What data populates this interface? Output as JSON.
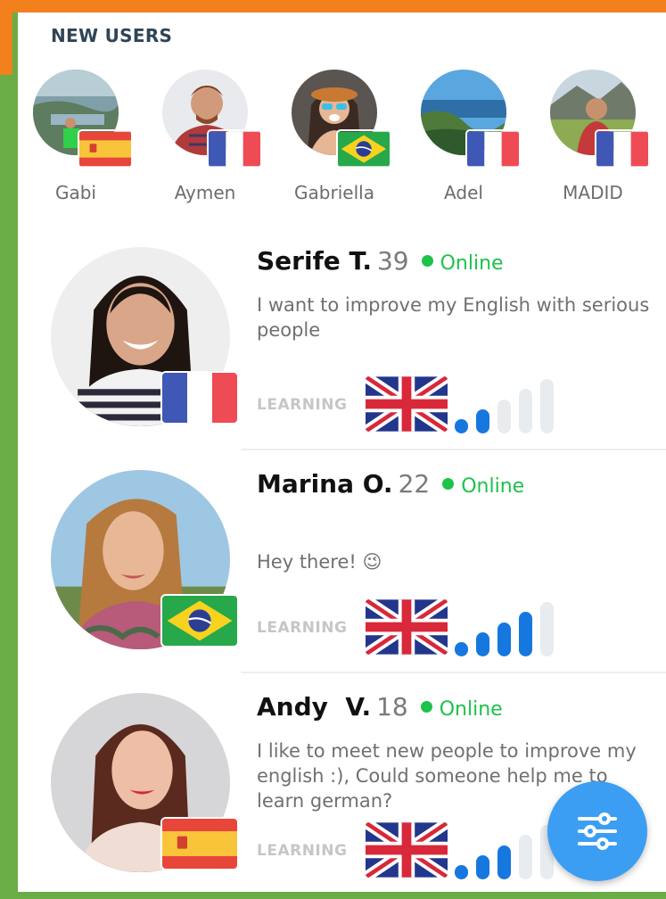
{
  "section": {
    "title": "NEW USERS"
  },
  "new_users": [
    {
      "name": "Gabi",
      "flag": "spain-flag"
    },
    {
      "name": "Aymen",
      "flag": "france-flag"
    },
    {
      "name": "Gabriella",
      "flag": "brazil-flag"
    },
    {
      "name": "Adel",
      "flag": "france-flag"
    },
    {
      "name": "MADID",
      "flag": "france-flag"
    }
  ],
  "users": [
    {
      "name": "Serife T.",
      "age": "39",
      "status": "Online",
      "bio": "I want to improve my English with serious people",
      "flag": "france-flag",
      "learning_label": "LEARNING",
      "learning_flag": "uk-flag",
      "level": 2,
      "level_max": 5
    },
    {
      "name": "Marina O.",
      "age": "22",
      "status": "Online",
      "bio": "Hey there! 😉",
      "flag": "brazil-flag",
      "learning_label": "LEARNING",
      "learning_flag": "uk-flag",
      "level": 4,
      "level_max": 5
    },
    {
      "name": "Andy  V.",
      "age": "18",
      "status": "Online",
      "bio": "I like to meet new people to improve my english :), Could someone help me to learn german?",
      "flag": "spain-flag",
      "learning_label": "LEARNING",
      "learning_flag": "uk-flag",
      "level": 3,
      "level_max": 5
    }
  ],
  "filter_button": {
    "icon": "sliders-icon"
  },
  "colors": {
    "accent": "#3b9ef3",
    "online": "#1dc24a",
    "level_on": "#1677df",
    "frame_green": "#6aac45",
    "frame_orange": "#f2811d"
  }
}
